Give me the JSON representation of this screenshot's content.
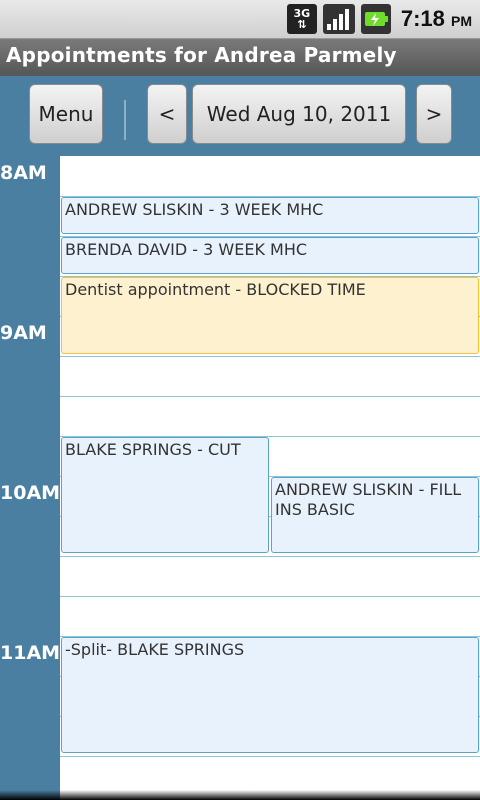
{
  "status_bar": {
    "network_icon": "3g-icon",
    "network_label_top": "3G",
    "signal_icon": "signal-icon",
    "battery_icon": "battery-charging-icon",
    "time": "7:18",
    "ampm": "PM"
  },
  "title_bar": {
    "title": "Appointments for Andrea Parmely"
  },
  "toolbar": {
    "menu_label": "Menu",
    "prev_label": "<",
    "date_label": "Wed Aug 10, 2011",
    "next_label": ">"
  },
  "schedule": {
    "hours": [
      "8AM",
      "9AM",
      "10AM",
      "11AM"
    ],
    "appointments": [
      {
        "text": "ANDREW SLISKIN - 3 WEEK MHC",
        "type": "normal"
      },
      {
        "text": "BRENDA DAVID - 3 WEEK MHC",
        "type": "normal"
      },
      {
        "text": "Dentist appointment - BLOCKED TIME",
        "type": "blocked"
      },
      {
        "text": "BLAKE SPRINGS - CUT",
        "type": "normal"
      },
      {
        "text": "ANDREW SLISKIN - FILL INS BASIC",
        "type": "normal"
      },
      {
        "text": "-Split- BLAKE SPRINGS",
        "type": "normal"
      }
    ]
  },
  "colors": {
    "toolbar_bg": "#4a7fa2",
    "appt_bg": "#e8f2fc",
    "appt_border": "#5aa3cf",
    "blocked_bg": "#fdf1cf",
    "blocked_border": "#f1c040"
  }
}
